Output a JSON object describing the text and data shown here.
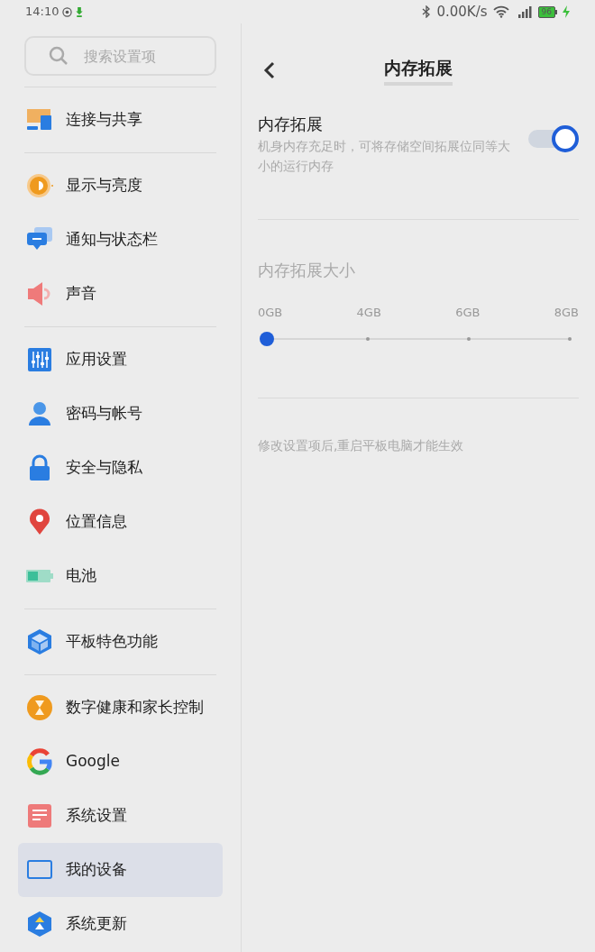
{
  "status_bar": {
    "time": "14:10",
    "speed": "0.00K/s",
    "battery": "96",
    "charging": true
  },
  "sidebar": {
    "search": {
      "placeholder": "搜索设置项"
    },
    "groups": [
      {
        "items": [
          {
            "label": "连接与共享",
            "kind": "connect",
            "selected": false
          }
        ]
      },
      {
        "items": [
          {
            "label": "显示与亮度",
            "kind": "display",
            "selected": false
          },
          {
            "label": "通知与状态栏",
            "kind": "notify",
            "selected": false
          },
          {
            "label": "声音",
            "kind": "sound",
            "selected": false
          }
        ]
      },
      {
        "items": [
          {
            "label": "应用设置",
            "kind": "apps",
            "selected": false
          },
          {
            "label": "密码与帐号",
            "kind": "account",
            "selected": false
          },
          {
            "label": "安全与隐私",
            "kind": "lock",
            "selected": false
          },
          {
            "label": "位置信息",
            "kind": "location",
            "selected": false
          },
          {
            "label": "电池",
            "kind": "battery",
            "selected": false
          }
        ]
      },
      {
        "items": [
          {
            "label": "平板特色功能",
            "kind": "cube",
            "selected": false
          }
        ]
      },
      {
        "items": [
          {
            "label": "数字健康和家长控制",
            "kind": "hourglass",
            "selected": false
          },
          {
            "label": "Google",
            "kind": "google",
            "selected": false
          },
          {
            "label": "系统设置",
            "kind": "system",
            "selected": false
          },
          {
            "label": "我的设备",
            "kind": "device",
            "selected": true
          },
          {
            "label": "系统更新",
            "kind": "update",
            "selected": false
          }
        ]
      }
    ]
  },
  "detail": {
    "title": "内存拓展",
    "toggle": {
      "title": "内存拓展",
      "description": "机身内存充足时，可将存储空间拓展位同等大小的运行内存",
      "on": true
    },
    "size": {
      "title": "内存拓展大小",
      "labels": [
        "0GB",
        "4GB",
        "6GB",
        "8GB"
      ],
      "level": 0
    },
    "note": "修改设置项后,重启平板电脑才能生效"
  }
}
